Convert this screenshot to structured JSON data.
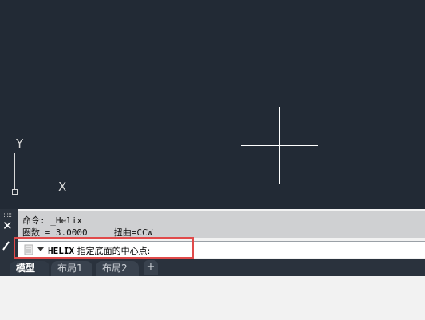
{
  "ucs": {
    "x_label": "X",
    "y_label": "Y"
  },
  "command_line": {
    "history": [
      "命令: _Helix",
      "圈数 = 3.0000     扭曲=CCW"
    ],
    "prompt_command": "HELIX",
    "prompt_text": "指定底面的中心点:"
  },
  "layout_tabs": {
    "tabs": [
      {
        "label": "模型",
        "active": true
      },
      {
        "label": "布局1",
        "active": false
      },
      {
        "label": "布局2",
        "active": false
      }
    ],
    "add_label": "+"
  },
  "colors": {
    "viewport_background": "#222a35",
    "highlight_border": "#e04a4a"
  }
}
